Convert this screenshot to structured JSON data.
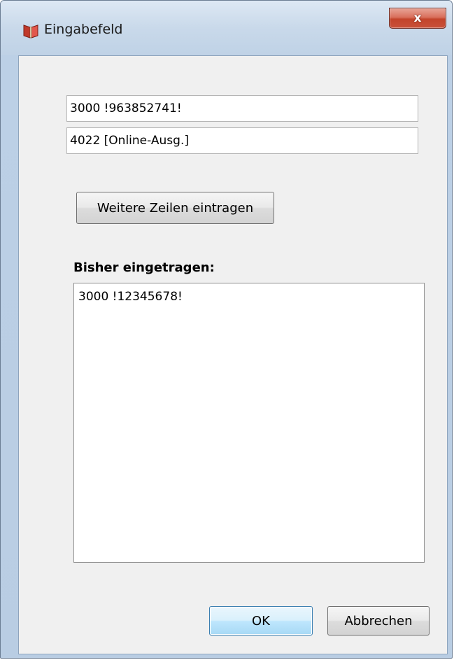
{
  "window": {
    "title": "Eingabefeld",
    "close_label": "x"
  },
  "fields": [
    {
      "value": "3000 !963852741!"
    },
    {
      "value": "4022 [Online-Ausg.]"
    }
  ],
  "buttons": {
    "more_label": "Weitere Zeilen eintragen",
    "ok_label": "OK",
    "cancel_label": "Abbrechen"
  },
  "history": {
    "heading": "Bisher eingetragen:",
    "lines": [
      "3000 !12345678!"
    ]
  },
  "colors": {
    "close_button": "#c8503a",
    "ok_accent": "#3c7fb1",
    "client_bg": "#f0f0f0"
  },
  "icons": {
    "app": "book-icon",
    "close": "close-icon"
  }
}
